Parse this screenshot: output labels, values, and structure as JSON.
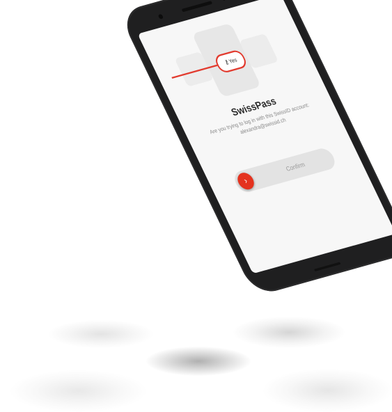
{
  "app": {
    "title": "SwissPass",
    "message": "Are you trying to log in with this SwissID account: alexandra@swissid.ch",
    "chip_label": "Yes",
    "chip_icon": "key-icon",
    "swipe_label": "Confirm",
    "swipe_knob_glyph": "›",
    "accent_color": "#e4321e"
  },
  "device": {
    "body_color": "#1f1f20",
    "screen_color": "#f7f7f7"
  }
}
